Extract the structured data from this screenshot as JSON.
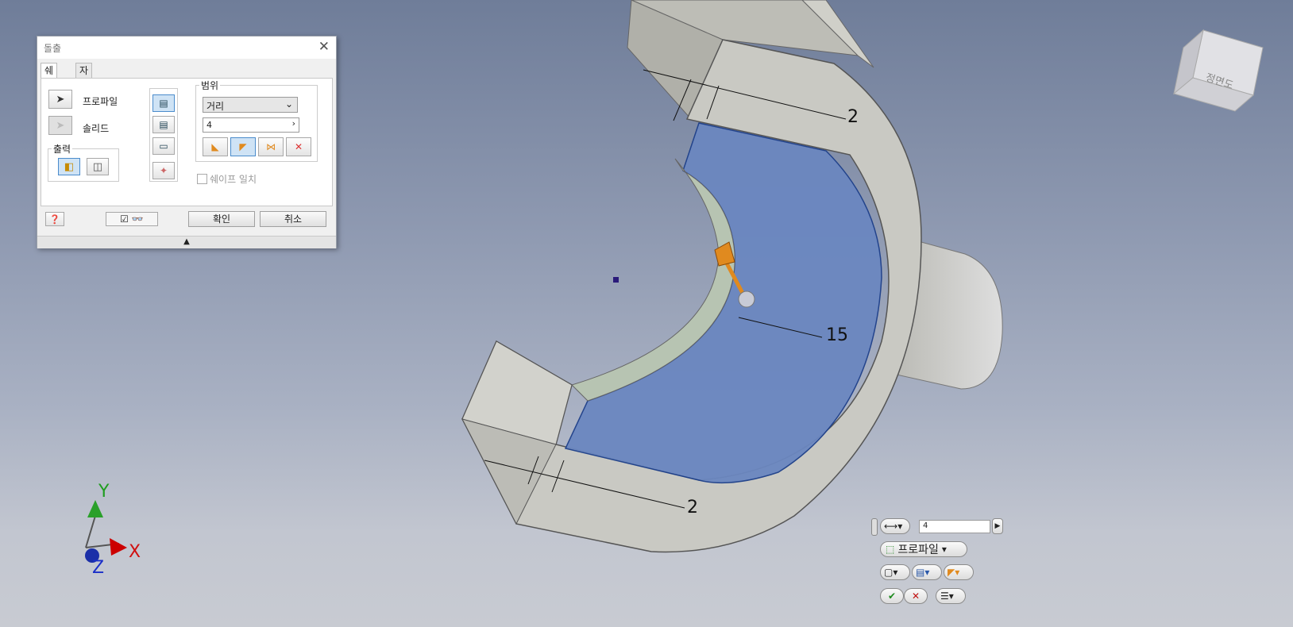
{
  "dialog": {
    "title": "돌출",
    "tabs": [
      "쉐이프",
      "자세히"
    ],
    "profile_label": "프로파일",
    "solid_label": "솔리드",
    "output_label": "출력",
    "extent_label": "범위",
    "extent_value": "거리",
    "distance_value": "4",
    "match_shape_label": "쉐이프 일치",
    "ok_label": "확인",
    "cancel_label": "취소"
  },
  "viewcube": {
    "face_label": "정면도"
  },
  "dimensions": {
    "top": "2",
    "middle": "15",
    "bottom": "2"
  },
  "axes": {
    "x": "X",
    "y": "Y",
    "z": "Z"
  },
  "minitoolbar": {
    "distance_value": "4",
    "profile_label": "프로파일"
  },
  "colors": {
    "face_highlight": "#6b87c0",
    "part": "#c9c9c3",
    "arrow": "#e08a1f"
  }
}
